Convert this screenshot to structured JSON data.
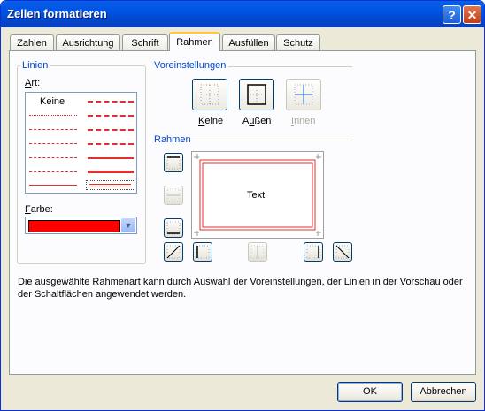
{
  "window": {
    "title": "Zellen formatieren"
  },
  "titlebar": {
    "help_label": "?",
    "close_label": "✕"
  },
  "tabs": [
    {
      "label": "Zahlen"
    },
    {
      "label": "Ausrichtung"
    },
    {
      "label": "Schrift"
    },
    {
      "label": "Rahmen"
    },
    {
      "label": "Ausfüllen"
    },
    {
      "label": "Schutz"
    }
  ],
  "active_tab": "Rahmen",
  "linien": {
    "group_label": "Linien",
    "art_label": "Art:",
    "art_access_key": "A",
    "none_style_label": "Keine",
    "farbe_label": "Farbe:",
    "farbe_access_key": "F",
    "selected_color": "#ff0000"
  },
  "voreinstellungen": {
    "group_label": "Voreinstellungen",
    "presets": [
      {
        "label": "Keine",
        "access_key": "K",
        "icon": "border-none-icon",
        "enabled": true
      },
      {
        "label": "Außen",
        "access_key": "u",
        "icon": "border-outline-icon",
        "enabled": true
      },
      {
        "label": "Innen",
        "access_key": "I",
        "icon": "border-inside-icon",
        "enabled": false
      }
    ]
  },
  "rahmen": {
    "group_label": "Rahmen",
    "preview_text": "Text"
  },
  "description": "Die ausgewählte Rahmenart kann durch Auswahl der Voreinstellungen, der Linien in der Vorschau oder der Schaltflächen angewendet werden.",
  "buttons": {
    "ok": "OK",
    "cancel": "Abbrechen"
  }
}
